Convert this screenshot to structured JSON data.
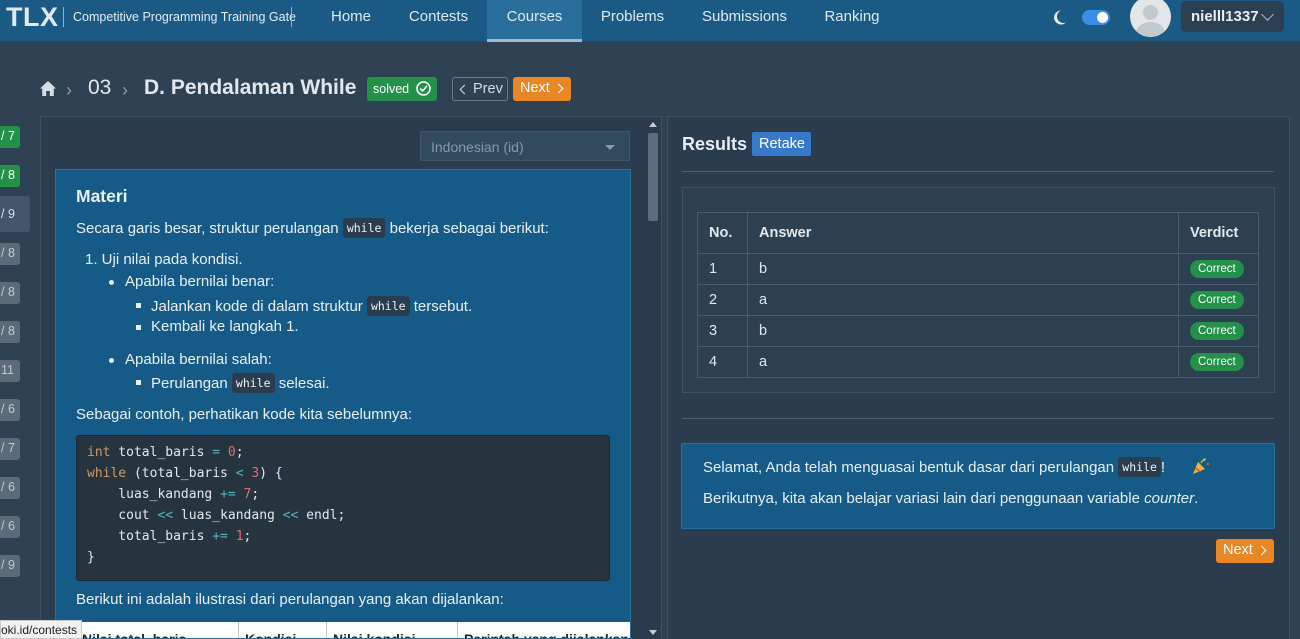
{
  "navbar": {
    "logo": "TLX",
    "tagline": "Competitive Programming Training Gate",
    "items": [
      {
        "label": "Home"
      },
      {
        "label": "Contests"
      },
      {
        "label": "Courses"
      },
      {
        "label": "Problems"
      },
      {
        "label": "Submissions"
      },
      {
        "label": "Ranking"
      }
    ],
    "active_item": "Courses",
    "dark_mode": true,
    "username": "nielll1337"
  },
  "breadcrumb": {
    "chapter": "03",
    "lesson": "D. Pendalaman While",
    "status": "solved",
    "prev_label": "Prev",
    "next_label": "Next"
  },
  "progress_tabs": [
    {
      "label": "/ 7",
      "state": "complete"
    },
    {
      "label": "/ 8",
      "state": "complete"
    },
    {
      "label": "/ 9",
      "state": "current"
    },
    {
      "label": "/ 8",
      "state": "pending"
    },
    {
      "label": "/ 8",
      "state": "pending"
    },
    {
      "label": "/ 8",
      "state": "pending"
    },
    {
      "label": "11",
      "state": "pending"
    },
    {
      "label": "/ 6",
      "state": "pending"
    },
    {
      "label": "/ 7",
      "state": "pending"
    },
    {
      "label": "/ 6",
      "state": "pending"
    },
    {
      "label": "/ 6",
      "state": "pending"
    },
    {
      "label": "/ 9",
      "state": "pending"
    }
  ],
  "language_select": {
    "value": "Indonesian (id)"
  },
  "materi": {
    "title": "Materi",
    "intro_a": "Secara garis besar, struktur perulangan",
    "intro_code": "while",
    "intro_b": "bekerja sebagai berikut:",
    "step1": "1. Uji nilai pada kondisi.",
    "true_case": "Apabila bernilai benar:",
    "true_item1_a": "Jalankan kode di dalam struktur",
    "true_item1_code": "while",
    "true_item1_b": "tersebut.",
    "true_item2": "Kembali ke langkah 1.",
    "false_case": "Apabila bernilai salah:",
    "false_item1_a": "Perulangan",
    "false_item1_code": "while",
    "false_item1_b": "selesai.",
    "example_intro": "Sebagai contoh, perhatikan kode kita sebelumnya:",
    "code_lines": [
      "int total_baris = 0;",
      "while (total_baris < 3) {",
      "    luas_kandang += 7;",
      "    cout << luas_kandang << endl;",
      "    total_baris += 1;",
      "}"
    ],
    "illustration_intro": "Berikut ini adalah ilustrasi dari perulangan yang akan dijalankan:",
    "table_headers": [
      "Nilai total_baris",
      "Kondisi",
      "Nilai kondisi",
      "Perintah yang dijalankan"
    ]
  },
  "status_url": "oki.id/contests",
  "results": {
    "title": "Results",
    "retake_label": "Retake",
    "columns": [
      "No.",
      "Answer",
      "Verdict"
    ],
    "rows": [
      {
        "no": "1",
        "answer": "b",
        "verdict": "Correct"
      },
      {
        "no": "2",
        "answer": "a",
        "verdict": "Correct"
      },
      {
        "no": "3",
        "answer": "b",
        "verdict": "Correct"
      },
      {
        "no": "4",
        "answer": "a",
        "verdict": "Correct"
      }
    ],
    "congrats_a": "Selamat, Anda telah menguasai bentuk dasar dari perulangan",
    "congrats_code": "while",
    "congrats_b": "!",
    "next_intro": "Berikutnya, kita akan belajar variasi lain dari penggunaan variable",
    "next_intro_em": "counter",
    "next_intro_end": ".",
    "next_label": "Next"
  },
  "colors": {
    "navbar": "#1b5a85",
    "background": "#2f4254",
    "panel": "#2a3c4d",
    "content_blue": "#165b88",
    "success": "#23914a",
    "accent_orange": "#e98724",
    "retake_blue": "#3779c9"
  },
  "icons": [
    "home-icon",
    "moon-icon",
    "check-circle-icon",
    "chevron-left-icon",
    "chevron-right-icon",
    "chevron-down-icon",
    "party-popper-icon",
    "user-avatar-icon"
  ]
}
